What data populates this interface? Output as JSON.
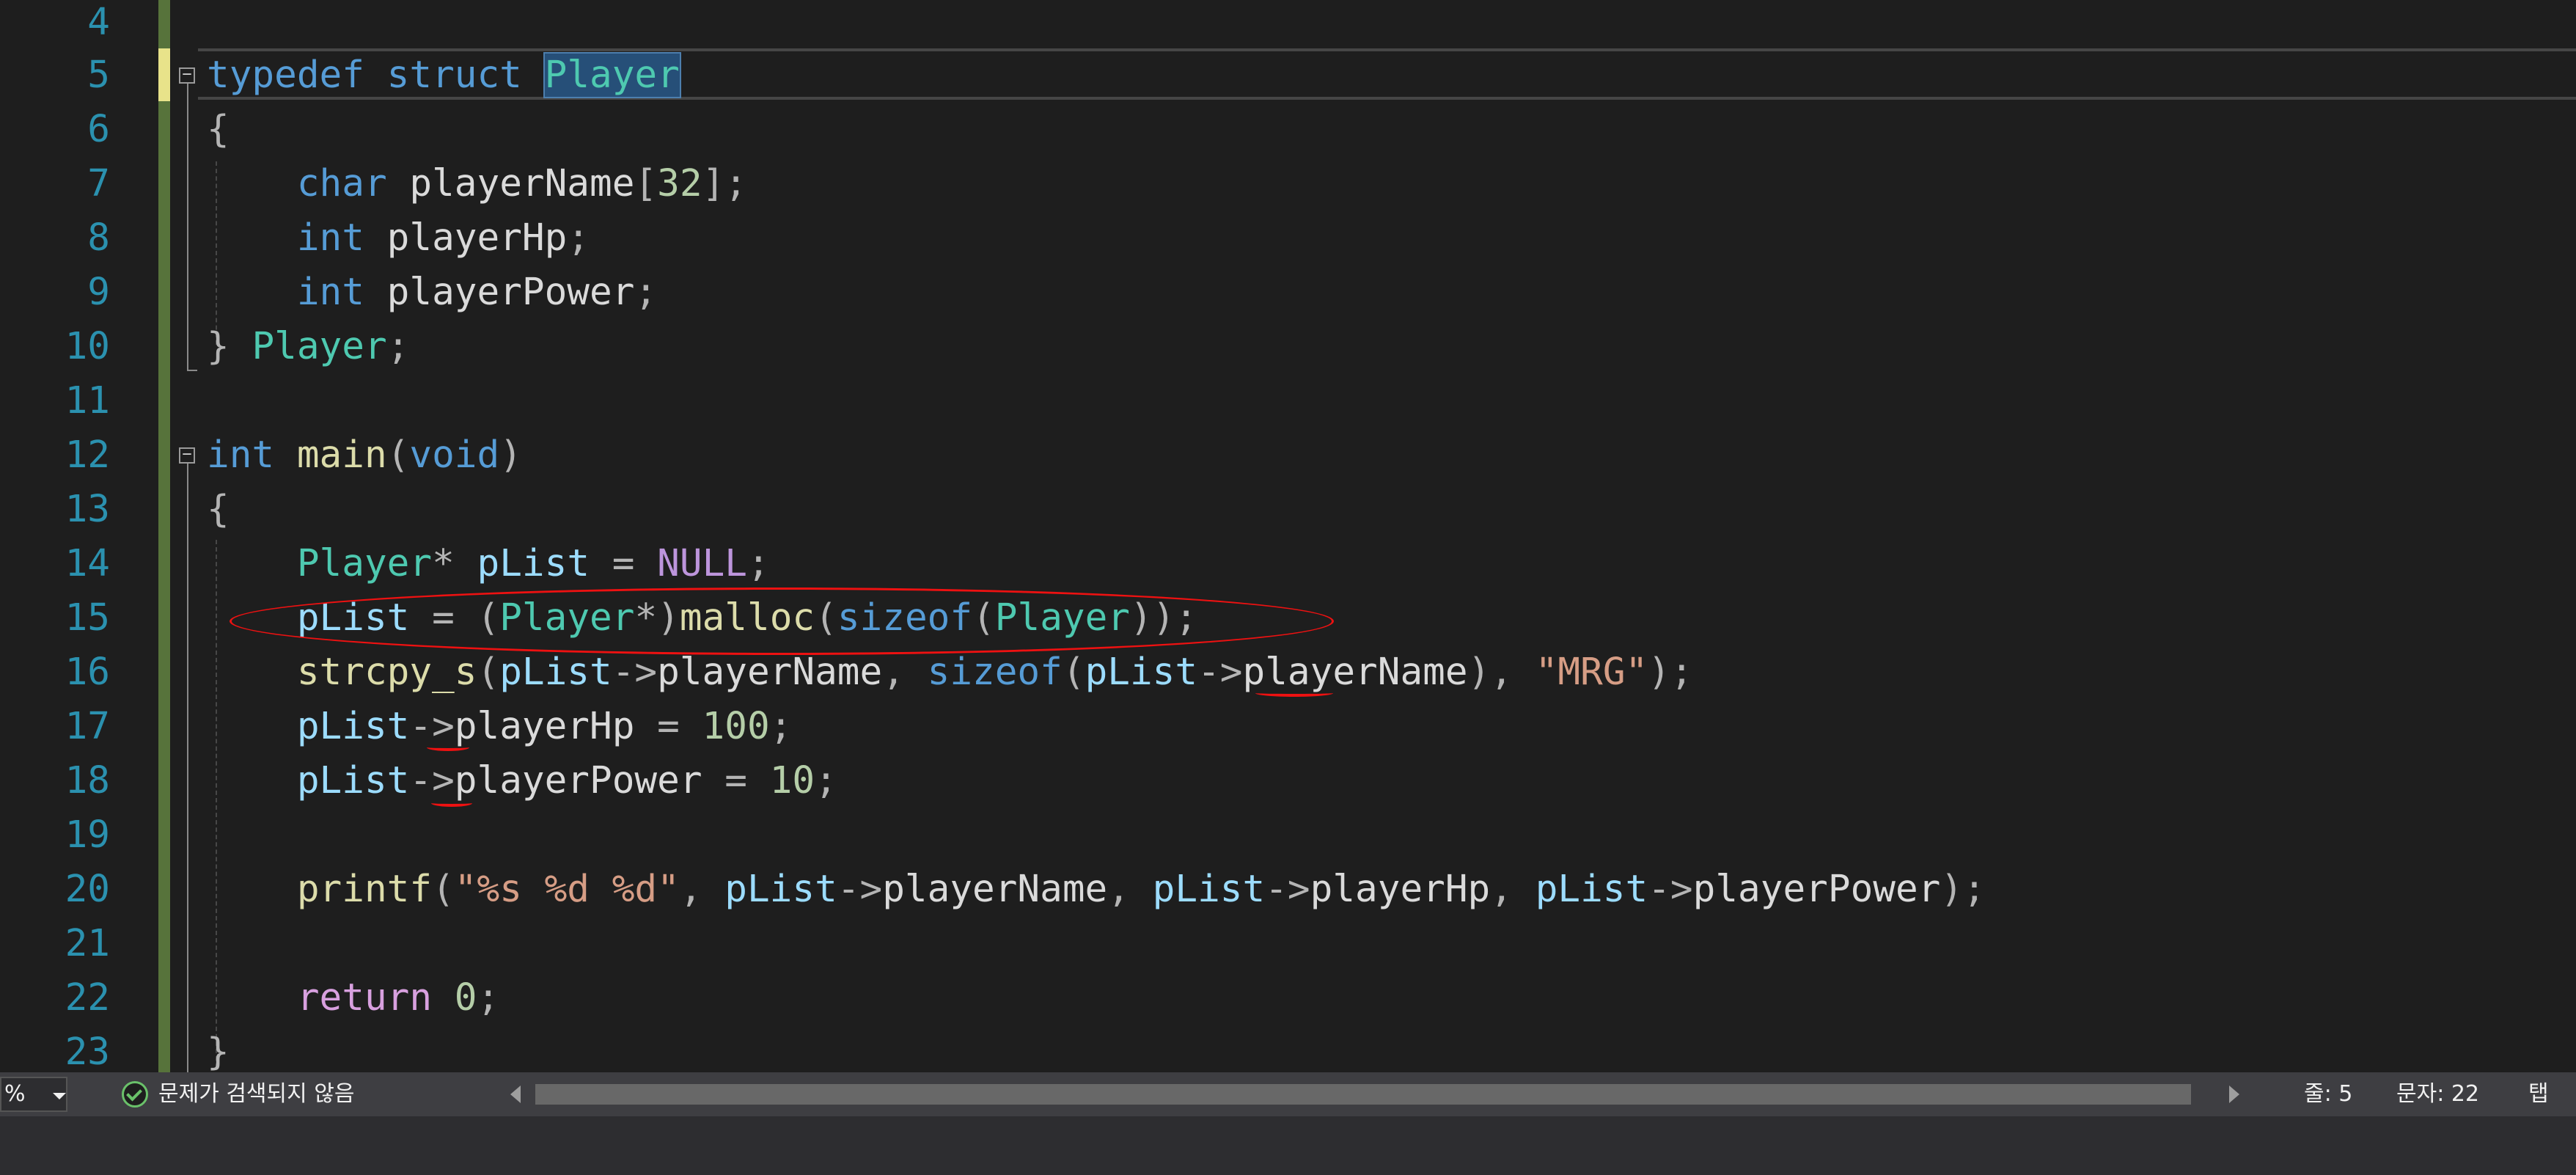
{
  "editor": {
    "line_numbers": [
      "4",
      "5",
      "6",
      "7",
      "8",
      "9",
      "10",
      "11",
      "12",
      "13",
      "14",
      "15",
      "16",
      "17",
      "18",
      "19",
      "20",
      "21",
      "22",
      "23"
    ],
    "lines": {
      "l5": {
        "kw1": "typedef",
        "sp1": " ",
        "kw2": "struct",
        "sp2": " ",
        "name": "Player"
      },
      "l6": {
        "brace": "{"
      },
      "l7": {
        "indent": "    ",
        "kw": "char",
        "sp": " ",
        "ident": "playerName",
        "lb": "[",
        "num": "32",
        "rb": "]",
        "semi": ";"
      },
      "l8": {
        "indent": "    ",
        "kw": "int",
        "sp": " ",
        "ident": "playerHp",
        "semi": ";"
      },
      "l9": {
        "indent": "    ",
        "kw": "int",
        "sp": " ",
        "ident": "playerPower",
        "semi": ";"
      },
      "l10": {
        "brace": "}",
        "sp": " ",
        "type": "Player",
        "semi": ";"
      },
      "l12": {
        "kw": "int",
        "sp": " ",
        "fn": "main",
        "lp": "(",
        "param": "void",
        "rp": ")"
      },
      "l13": {
        "brace": "{"
      },
      "l14": {
        "indent": "    ",
        "type": "Player",
        "star": "*",
        "sp": " ",
        "var": "pList",
        "eq": " = ",
        "mac": "NULL",
        "semi": ";"
      },
      "l15": {
        "indent": "    ",
        "var": "pList",
        "eq": " = ",
        "lp": "(",
        "type": "Player",
        "star": "*",
        "rp": ")",
        "fn": "malloc",
        "lp2": "(",
        "kw": "sizeof",
        "lp3": "(",
        "type2": "Player",
        "end": "));"
      },
      "l16": {
        "indent": "    ",
        "fn": "strcpy_s",
        "lp": "(",
        "var1": "pList",
        "arrow1": "->",
        "mem1": "playerName",
        "comma1": ", ",
        "kw": "sizeof",
        "lp2": "(",
        "var2": "pList",
        "arrow2": "->",
        "mem2": "playerName",
        "rp": ")",
        "comma2": ", ",
        "str": "\"MRG\"",
        "end": ");"
      },
      "l17": {
        "indent": "    ",
        "var": "pList",
        "arrow": "->",
        "mem": "playerHp",
        "eq": " = ",
        "num": "100",
        "semi": ";"
      },
      "l18": {
        "indent": "    ",
        "var": "pList",
        "arrow": "->",
        "mem": "playerPower",
        "eq": " = ",
        "num": "10",
        "semi": ";"
      },
      "l20": {
        "indent": "    ",
        "fn": "printf",
        "lp": "(",
        "str": "\"%s %d %d\"",
        "comma1": ", ",
        "var1": "pList",
        "arrow1": "->",
        "mem1": "playerName",
        "comma2": ", ",
        "var2": "pList",
        "arrow2": "->",
        "mem2": "playerHp",
        "comma3": ", ",
        "var3": "pList",
        "arrow3": "->",
        "mem3": "playerPower",
        "end": ");"
      },
      "l22": {
        "indent": "    ",
        "kw": "return",
        "sp": " ",
        "num": "0",
        "semi": ";"
      },
      "l23": {
        "brace": "}"
      }
    }
  },
  "statusbar": {
    "zoom": "%",
    "issues_text": "문제가 검색되지 않음",
    "line": "줄: 5",
    "char": "문자: 22",
    "tab": "탭"
  },
  "colors": {
    "background": "#1e1e1e",
    "line_number": "#2b91af",
    "keyword": "#569cd6",
    "control_keyword": "#d8a0df",
    "type": "#4ec9b0",
    "function": "#dcdcaa",
    "variable": "#9cdcfe",
    "number": "#b5cea8",
    "string": "#d69d85",
    "annotation": "#ee1111",
    "change_bar": "#57733b"
  }
}
